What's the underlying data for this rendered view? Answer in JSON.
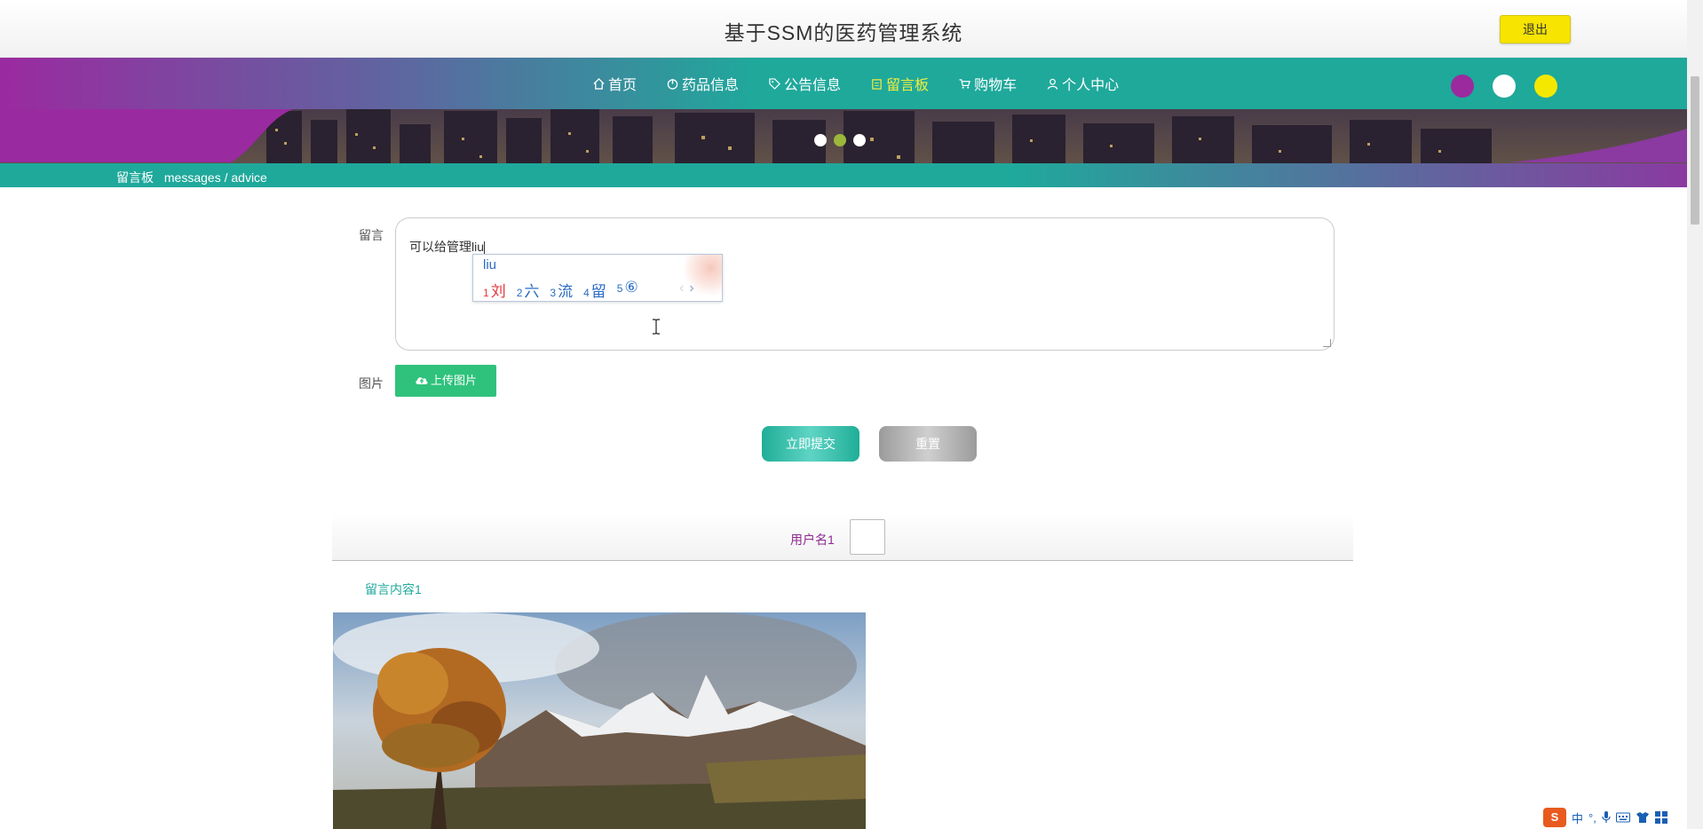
{
  "header": {
    "title": "基于SSM的医药管理系统",
    "logout_label": "退出"
  },
  "nav": {
    "items": [
      {
        "label": "首页",
        "icon": "home-icon",
        "active": false
      },
      {
        "label": "药品信息",
        "icon": "power-icon",
        "active": false
      },
      {
        "label": "公告信息",
        "icon": "tag-icon",
        "active": false
      },
      {
        "label": "留言板",
        "icon": "clipboard-icon",
        "active": true
      },
      {
        "label": "购物车",
        "icon": "cart-icon",
        "active": false
      },
      {
        "label": "个人中心",
        "icon": "user-icon",
        "active": false
      }
    ],
    "theme_colors": [
      "#9b2a9f",
      "#ffffff",
      "#f4e800"
    ],
    "active_color": "#f4ee3c",
    "primary_color": "#1fa99b"
  },
  "banner": {
    "slide_count": 3,
    "active_slide": 2
  },
  "breadcrumb": {
    "current": "留言板",
    "subtitle": "messages / advice"
  },
  "form": {
    "message_label": "留言",
    "message_value": "可以给管理liu",
    "image_label": "图片",
    "upload_label": "上传图片",
    "submit_label": "立即提交",
    "reset_label": "重置"
  },
  "ime": {
    "input": "liu",
    "candidates": [
      {
        "num": "1",
        "text": "刘"
      },
      {
        "num": "2",
        "text": "六"
      },
      {
        "num": "3",
        "text": "流"
      },
      {
        "num": "4",
        "text": "留"
      },
      {
        "num": "5",
        "text": "⑥"
      }
    ],
    "prev": "‹",
    "next": "›"
  },
  "messages": [
    {
      "username": "用户名1",
      "content": "留言内容1"
    }
  ],
  "tray": {
    "logo": "S",
    "lang": "中",
    "punct": "°,"
  }
}
